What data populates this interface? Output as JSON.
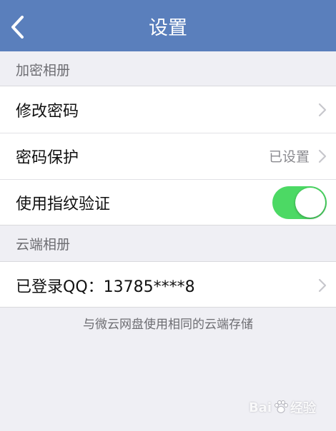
{
  "navbar": {
    "title": "设置",
    "back_icon": "chevron-left-icon"
  },
  "sections": {
    "encrypted_album": {
      "header": "加密相册",
      "change_password_label": "修改密码",
      "password_protection_label": "密码保护",
      "password_protection_value": "已设置",
      "fingerprint_label": "使用指纹验证",
      "fingerprint_enabled": true
    },
    "cloud_album": {
      "header": "云端相册",
      "logged_in_label": "已登录QQ：13785****8",
      "footnote": "与微云网盘使用相同的云端存储"
    }
  },
  "watermark": {
    "text_left": "Bai",
    "text_right": "经验"
  },
  "colors": {
    "navbar_bg": "#5a7fbc",
    "page_bg": "#efeff4",
    "toggle_on": "#4cd964"
  }
}
